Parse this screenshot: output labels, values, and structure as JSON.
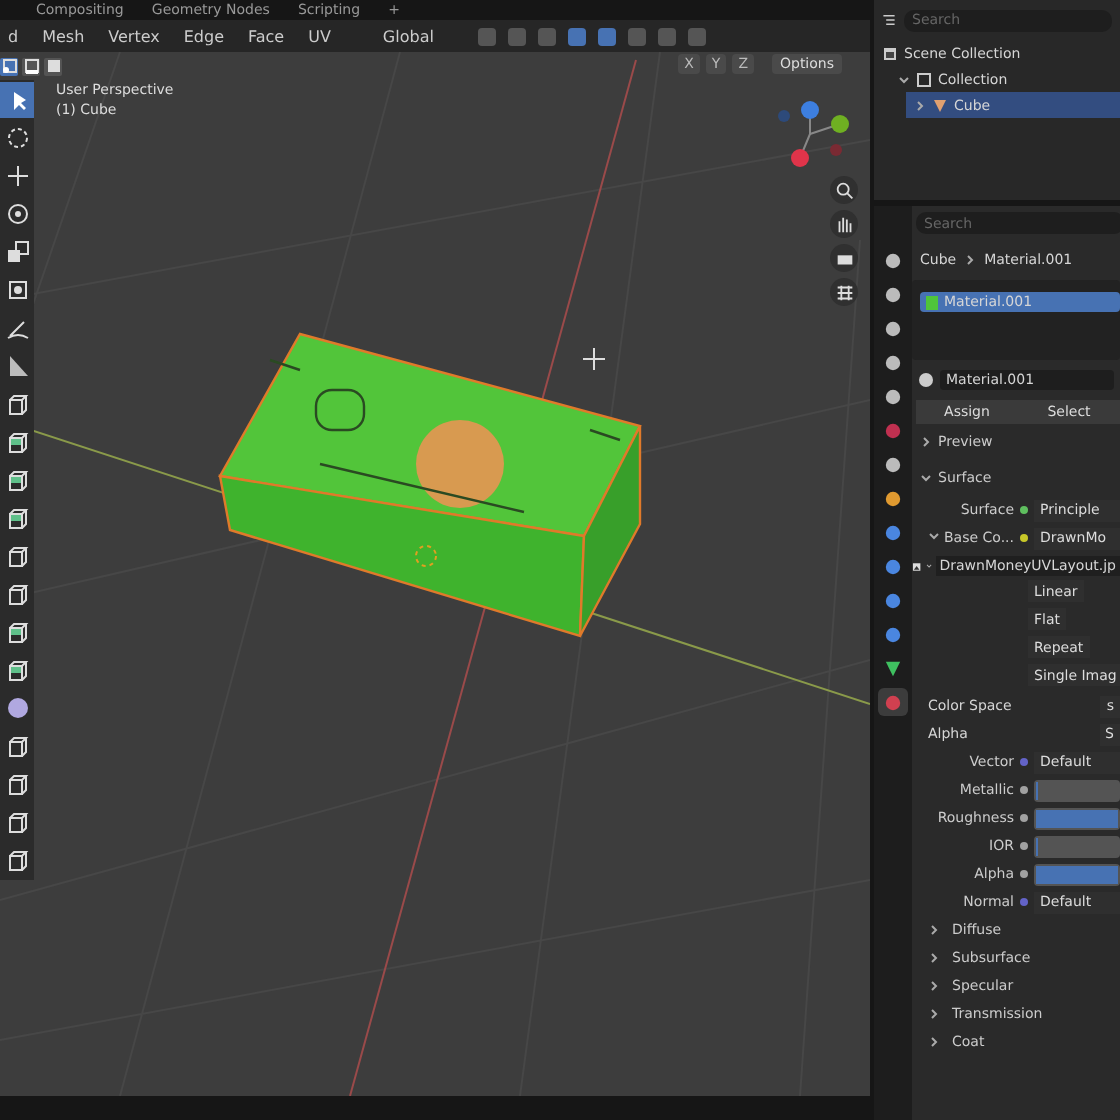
{
  "workspace_tabs": [
    {
      "label": "Compositing",
      "selected": false
    },
    {
      "label": "Geometry Nodes",
      "selected": false
    },
    {
      "label": "Scripting",
      "selected": false
    },
    {
      "label": "+",
      "selected": false
    }
  ],
  "header": {
    "menus": [
      "d",
      "Mesh",
      "Vertex",
      "Edge",
      "Face",
      "UV"
    ],
    "orientation": "Global",
    "select_modes": [
      {
        "kind": "vertex",
        "selected": true
      },
      {
        "kind": "edge",
        "selected": false
      },
      {
        "kind": "face",
        "selected": false
      }
    ],
    "mirror_axes": [
      "X",
      "Y",
      "Z"
    ],
    "options": "Options"
  },
  "viewport": {
    "view_name": "User Perspective",
    "object_label": "(1) Cube"
  },
  "toolbar": [
    {
      "kind": "select",
      "selected": true
    },
    {
      "kind": "cursor",
      "selected": false
    },
    {
      "kind": "move",
      "selected": false
    },
    {
      "kind": "rotate",
      "selected": false
    },
    {
      "kind": "scale",
      "selected": false
    },
    {
      "kind": "transform",
      "selected": false
    },
    {
      "kind": "annotate",
      "selected": false
    },
    {
      "kind": "measure",
      "selected": false
    },
    {
      "kind": "add_cube",
      "selected": false
    },
    {
      "kind": "extrude",
      "selected": false
    },
    {
      "kind": "inset",
      "selected": false
    },
    {
      "kind": "bevel",
      "selected": false
    },
    {
      "kind": "loop_cut",
      "selected": false
    },
    {
      "kind": "knife",
      "selected": false
    },
    {
      "kind": "poly_build",
      "selected": false
    },
    {
      "kind": "spin",
      "selected": false
    },
    {
      "kind": "smooth",
      "selected": false
    },
    {
      "kind": "edge_slide",
      "selected": false
    },
    {
      "kind": "shrink",
      "selected": false
    },
    {
      "kind": "shear",
      "selected": false
    },
    {
      "kind": "rip",
      "selected": false
    }
  ],
  "outliner": {
    "search_placeholder": "Search",
    "tree": [
      {
        "label": "Scene Collection",
        "kind": "scene",
        "selected": false,
        "children": [
          {
            "label": "Collection",
            "kind": "collection",
            "selected": false,
            "expanded": true,
            "children": [
              {
                "label": "Cube",
                "kind": "mesh",
                "selected": true,
                "expanded": false
              }
            ]
          }
        ]
      }
    ]
  },
  "properties": {
    "search_placeholder": "Search",
    "tabs": [
      {
        "kind": "tool",
        "selected": false
      },
      {
        "kind": "render",
        "selected": false
      },
      {
        "kind": "output",
        "selected": false
      },
      {
        "kind": "view_layer",
        "selected": false
      },
      {
        "kind": "scene",
        "selected": false
      },
      {
        "kind": "world",
        "selected": false
      },
      {
        "kind": "collection",
        "selected": false
      },
      {
        "kind": "object",
        "selected": false
      },
      {
        "kind": "modifier",
        "selected": false
      },
      {
        "kind": "particles",
        "selected": false
      },
      {
        "kind": "physics",
        "selected": false
      },
      {
        "kind": "constraints",
        "selected": false
      },
      {
        "kind": "data",
        "selected": false
      },
      {
        "kind": "material",
        "selected": true
      }
    ],
    "breadcrumb": [
      "Cube",
      "Material.001"
    ],
    "material_slots": [
      {
        "label": "Material.001",
        "selected": true
      }
    ],
    "material_name": "Material.001",
    "slot_buttons": [
      "Assign",
      "Select"
    ],
    "panels": [
      {
        "label": "Preview",
        "expanded": false
      },
      {
        "label": "Surface",
        "expanded": true
      }
    ],
    "surface_rows": [
      {
        "kind": "link",
        "label": "Surface",
        "value": "Principle",
        "color": "#5fbf5f"
      },
      {
        "kind": "link",
        "label": "Base Co...",
        "value": "DrawnMo",
        "color": "#c7c729",
        "expanded": true
      },
      {
        "kind": "image",
        "value": "DrawnMoneyUVLayout.jp"
      },
      {
        "kind": "dropdown",
        "value": "Linear"
      },
      {
        "kind": "dropdown",
        "value": "Flat"
      },
      {
        "kind": "dropdown",
        "value": "Repeat"
      },
      {
        "kind": "dropdown",
        "value": "Single Imag"
      },
      {
        "kind": "setting",
        "label": "Color Space",
        "value": "s"
      },
      {
        "kind": "setting",
        "label": "Alpha",
        "value": "S"
      },
      {
        "kind": "link",
        "label": "Vector",
        "value": "Default",
        "color": "#6363c7"
      },
      {
        "kind": "slider",
        "label": "Metallic",
        "level": 0,
        "color": "#a1a1a1"
      },
      {
        "kind": "slider",
        "label": "Roughness",
        "level": 1,
        "color": "#a1a1a1"
      },
      {
        "kind": "slider",
        "label": "IOR",
        "level": 0,
        "color": "#a1a1a1"
      },
      {
        "kind": "slider",
        "label": "Alpha",
        "level": 1,
        "color": "#a1a1a1"
      },
      {
        "kind": "link",
        "label": "Normal",
        "value": "Default",
        "color": "#6363c7"
      }
    ],
    "subpanels": [
      {
        "label": "Diffuse",
        "expanded": false
      },
      {
        "label": "Subsurface",
        "expanded": false
      },
      {
        "label": "Specular",
        "expanded": false
      },
      {
        "label": "Transmission",
        "expanded": false
      },
      {
        "label": "Coat",
        "expanded": false
      }
    ]
  }
}
